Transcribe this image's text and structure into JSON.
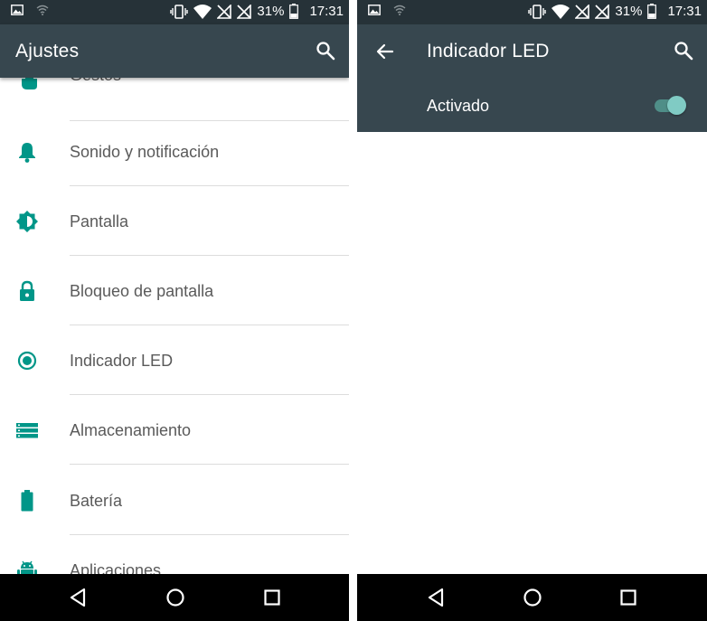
{
  "status_bar": {
    "battery_percent": "31%",
    "time": "17:31"
  },
  "left_screen": {
    "title": "Ajustes",
    "items": [
      {
        "label": "Gestos",
        "icon": "gesture-hand-icon"
      },
      {
        "label": "Sonido y notificación",
        "icon": "bell-icon"
      },
      {
        "label": "Pantalla",
        "icon": "brightness-icon"
      },
      {
        "label": "Bloqueo de pantalla",
        "icon": "lock-icon"
      },
      {
        "label": "Indicador LED",
        "icon": "led-indicator-icon"
      },
      {
        "label": "Almacenamiento",
        "icon": "storage-icon"
      },
      {
        "label": "Batería",
        "icon": "battery-icon"
      },
      {
        "label": "Aplicaciones",
        "icon": "android-icon"
      }
    ]
  },
  "right_screen": {
    "title": "Indicador LED",
    "switch": {
      "label": "Activado",
      "checked": true
    }
  },
  "colors": {
    "status_bar": "#263238",
    "app_bar": "#37474f",
    "accent": "#009688",
    "switch_on": "#80cbc4"
  }
}
